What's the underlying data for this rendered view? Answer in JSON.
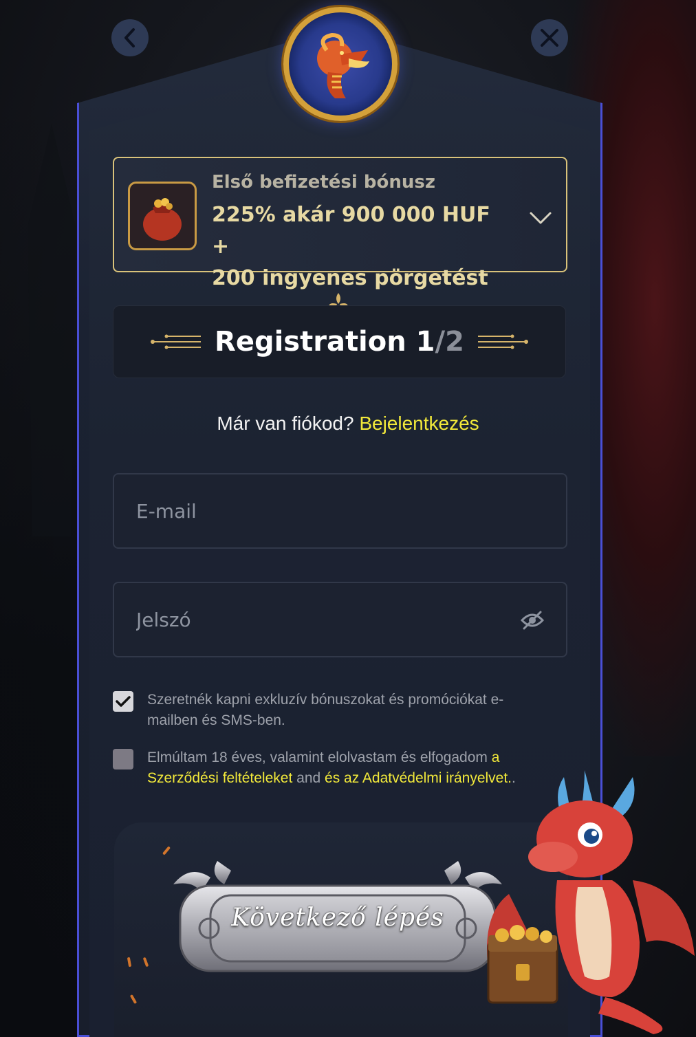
{
  "nav": {
    "back_icon": "chevron-left-icon",
    "close_icon": "close-icon"
  },
  "bonus": {
    "subtitle": "Első befizetési bónusz",
    "headline_line1": "225% akár 900 000 HUF +",
    "headline_line2": "200 ingyenes pörgetést",
    "expand_icon": "chevron-down-icon"
  },
  "registration": {
    "title": "Registration",
    "step": "1",
    "separator": "/",
    "total": "2"
  },
  "login_prompt": {
    "text": "Már van fiókod?",
    "link": "Bejelentkezés"
  },
  "form": {
    "email_placeholder": "E-mail",
    "password_placeholder": "Jelszó"
  },
  "consents": {
    "promo": {
      "checked": true,
      "text": "Szeretnék kapni exkluzív bónuszokat és promóciókat e-mailben és SMS-ben."
    },
    "terms": {
      "checked": false,
      "text_before": "Elmúltam 18 éves, valamint elolvastam és elfogadom",
      "link_terms": "a Szerződési feltételeket",
      "and": "and",
      "link_privacy": "és az Adatvédelmi irányelvet.",
      "trailing": "."
    }
  },
  "cta": {
    "label": "Következő lépés"
  },
  "colors": {
    "accent_yellow": "#f2e93a",
    "panel_border": "#4a4fd6",
    "gold": "#d4a13a"
  }
}
